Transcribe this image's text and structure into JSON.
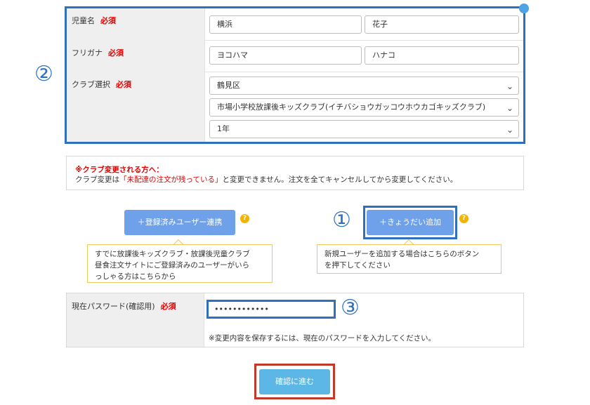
{
  "form": {
    "child_name": {
      "label": "児童名",
      "required": "必須",
      "last_name": "横浜",
      "first_name": "花子"
    },
    "furigana": {
      "label": "フリガナ",
      "required": "必須",
      "last_name": "ヨコハマ",
      "first_name": "ハナコ"
    },
    "club": {
      "label": "クラブ選択",
      "required": "必須",
      "ward": "鶴見区",
      "school": "市場小学校放課後キッズクラブ(イチバショウガッコウホウカゴキッズクラブ)",
      "grade": "1年"
    }
  },
  "notice": {
    "title": "※クラブ変更される方へ：",
    "line_prefix": "クラブ変更は",
    "line_highlight": "「未配達の注文が残っている」",
    "line_suffix": "と変更できません。注文を全てキャンセルしてから変更してください。"
  },
  "actions": {
    "link_registered_user": "＋登録済みユーザー連携",
    "add_sibling": "＋きょうだい追加",
    "help_icon": "?",
    "tip_registered": [
      "すでに放課後キッズクラブ・放課後児童クラブ",
      "昼食注文サイトにご登録済みのユーザーがいら",
      "っしゃる方はこちらから"
    ],
    "tip_sibling": [
      "新規ユーザーを追加する場合はこちらのボタン",
      "を押下してください"
    ]
  },
  "password": {
    "label": "現在パスワード(確認用)",
    "required": "必須",
    "value": "••••••••••••",
    "note": "※変更内容を保存するには、現在のパスワードを入力してください。"
  },
  "submit_label": "確認に進む",
  "annotations": {
    "marker_1": "①",
    "marker_2": "②",
    "marker_3": "③"
  },
  "colors": {
    "annotation_blue": "#2f6fc0",
    "annotation_red": "#c0392b",
    "button_blue": "#6ea1ea",
    "submit_blue": "#5db7e6",
    "required_red": "#e10000",
    "help_orange": "#f3b300"
  }
}
